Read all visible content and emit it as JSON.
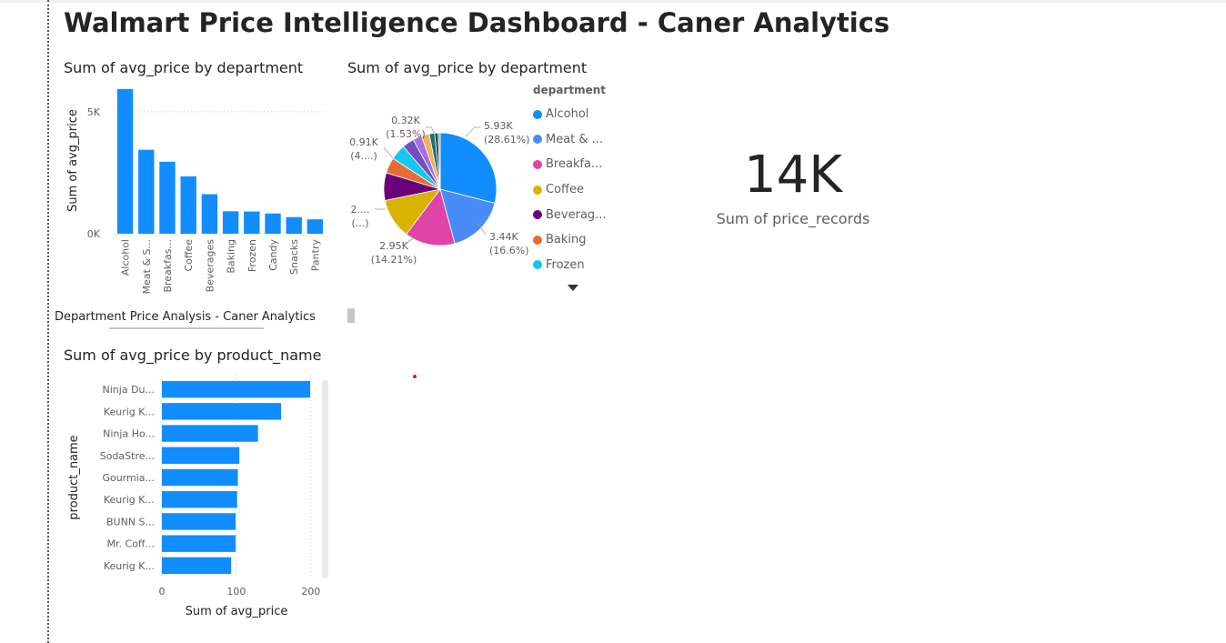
{
  "page": {
    "title": "Walmart Price Intelligence Dashboard - Caner Analytics"
  },
  "visuals": {
    "dept_bar": {
      "title": "Sum of avg_price by department",
      "ylabel": "Sum of avg_price",
      "yticks": [
        {
          "value": 5000,
          "label": "5K"
        },
        {
          "value": 0,
          "label": "0K"
        }
      ]
    },
    "dept_pie": {
      "title": "Sum of avg_price by department",
      "legend_title": "department",
      "legend_items": [
        "Alcohol",
        "Meat & ...",
        "Breakfa...",
        "Coffee",
        "Beverag...",
        "Baking",
        "Frozen"
      ],
      "legend_more_icon": "caret-down-icon"
    },
    "card": {
      "value": "14K",
      "label": "Sum of price_records"
    },
    "textbox": {
      "text": "Department Price Analysis - Caner Analytics"
    },
    "product_bar": {
      "title": "Sum of avg_price by product_name",
      "xlabel": "Sum of avg_price",
      "ylabel": "product_name",
      "xticks": [
        {
          "value": 0,
          "label": "0"
        },
        {
          "value": 100,
          "label": "100"
        },
        {
          "value": 200,
          "label": "200"
        }
      ]
    }
  },
  "colors": {
    "bar": "#118dff",
    "text": "#252423",
    "muted": "#605e5c"
  },
  "chart_data": [
    {
      "type": "bar",
      "title": "Sum of avg_price by department",
      "xlabel": "",
      "ylabel": "Sum of avg_price",
      "categories": [
        "Alcohol",
        "Meat & S...",
        "Breakfas...",
        "Coffee",
        "Beverages",
        "Baking",
        "Frozen",
        "Candy",
        "Snacks",
        "Pantry"
      ],
      "values": [
        5930,
        3440,
        2950,
        2350,
        1620,
        920,
        910,
        830,
        680,
        590
      ],
      "ylim": [
        0,
        6000
      ],
      "grid": true,
      "color": "#118dff"
    },
    {
      "type": "pie",
      "title": "Sum of avg_price by department",
      "legend_title": "department",
      "slices": [
        {
          "label": "Alcohol",
          "value": 5930,
          "percent": 28.61,
          "color": "#118dff"
        },
        {
          "label": "Meat & ...",
          "value": 3440,
          "percent": 16.6,
          "color": "#4a8cf7"
        },
        {
          "label": "Breakfa...",
          "value": 2950,
          "percent": 14.21,
          "color": "#e044a7"
        },
        {
          "label": "Coffee",
          "value": 2350,
          "percent": 11.3,
          "color": "#d9b300"
        },
        {
          "label": "Beverag...",
          "value": 1620,
          "percent": 7.8,
          "color": "#6b007b"
        },
        {
          "label": "Baking",
          "value": 920,
          "percent": 4.4,
          "color": "#e66c37"
        },
        {
          "label": "Frozen",
          "value": 910,
          "percent": 4.4,
          "color": "#14c7f0"
        },
        {
          "label": "",
          "value": 700,
          "percent": 3.4,
          "color": "#744ec2"
        },
        {
          "label": "",
          "value": 520,
          "percent": 2.5,
          "color": "#a66ee0"
        },
        {
          "label": "",
          "value": 460,
          "percent": 2.2,
          "color": "#f2b061"
        },
        {
          "label": "",
          "value": 320,
          "percent": 1.53,
          "color": "#197278"
        },
        {
          "label": "",
          "value": 200,
          "percent": 1.0,
          "color": "#3a3a3a"
        },
        {
          "label": "",
          "value": 120,
          "percent": 0.6,
          "color": "#5ac18e"
        }
      ],
      "data_labels": [
        {
          "value": "5.93K",
          "percent": "(28.61%)"
        },
        {
          "value": "3.44K",
          "percent": "(16.6%)"
        },
        {
          "value": "2.95K",
          "percent": "(14.21%)"
        },
        {
          "value": "2....",
          "percent": "(...)"
        },
        {
          "value": "0.91K",
          "percent": "(4....)"
        },
        {
          "value": "0.32K",
          "percent": "(1.53%)"
        }
      ]
    },
    {
      "type": "bar",
      "orientation": "horizontal",
      "title": "Sum of avg_price by product_name",
      "xlabel": "Sum of avg_price",
      "ylabel": "product_name",
      "categories": [
        "Ninja Du...",
        "Keurig K...",
        "Ninja Ho...",
        "SodaStre...",
        "Gourmia...",
        "Keurig K...",
        "BUNN S...",
        "Mr. Coff...",
        "Keurig K..."
      ],
      "values": [
        199,
        160,
        129,
        104,
        102,
        101,
        99,
        99,
        93
      ],
      "xlim": [
        0,
        210
      ],
      "grid": true,
      "color": "#118dff"
    }
  ]
}
